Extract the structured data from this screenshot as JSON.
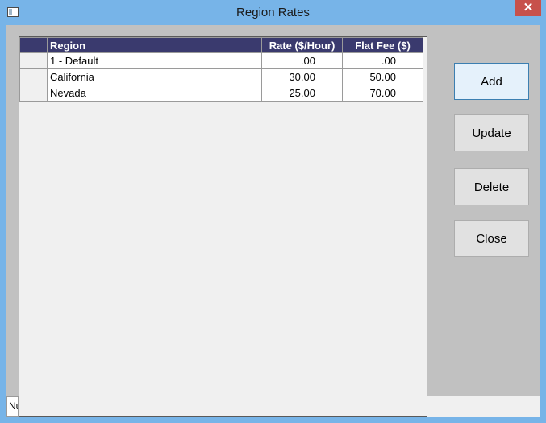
{
  "window": {
    "title": "Region Rates",
    "close_glyph": "✕"
  },
  "table": {
    "headers": {
      "region": "Region",
      "rate": "Rate ($/Hour)",
      "flat": "Flat Fee ($)"
    },
    "rows": [
      {
        "region": "1 - Default",
        "rate": ".00",
        "flat": ".00"
      },
      {
        "region": "California",
        "rate": "30.00",
        "flat": "50.00"
      },
      {
        "region": "Nevada",
        "rate": "25.00",
        "flat": "70.00"
      }
    ]
  },
  "buttons": {
    "add": "Add",
    "update": "Update",
    "delete": "Delete",
    "close": "Close"
  },
  "status": {
    "left_text": "Nu"
  },
  "colors": {
    "titlebar": "#77b4e8",
    "header_bg": "#3a3a6e",
    "close": "#c7514b"
  }
}
